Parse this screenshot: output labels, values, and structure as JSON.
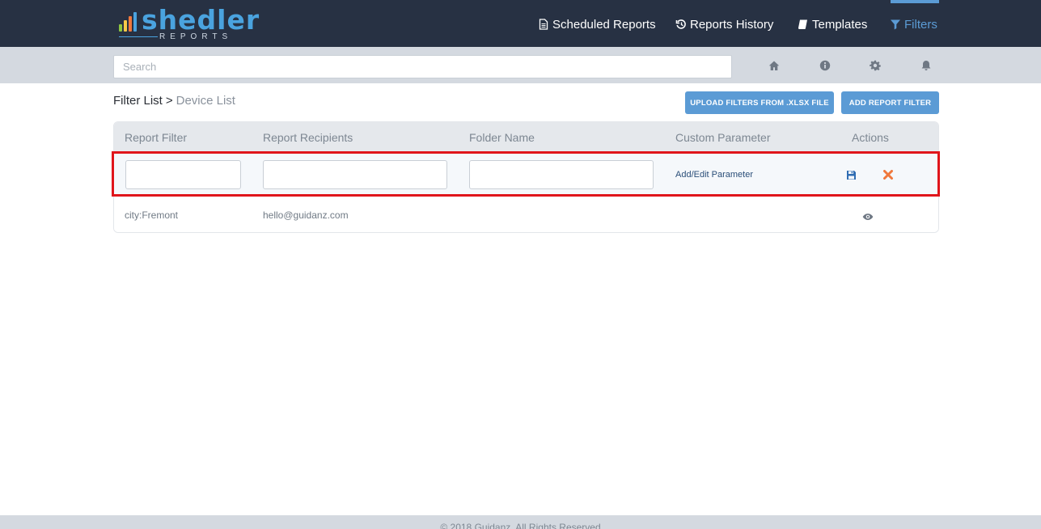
{
  "brand": {
    "name": "shedler",
    "sub": "REPORTS",
    "accent": "#4aa3df"
  },
  "nav": {
    "items": [
      {
        "label": "Scheduled Reports",
        "icon": "file-text-icon"
      },
      {
        "label": "Reports History",
        "icon": "history-icon"
      },
      {
        "label": "Templates",
        "icon": "book-icon"
      },
      {
        "label": "Filters",
        "icon": "filter-icon",
        "active": true
      }
    ],
    "active_color": "#5b9bd5"
  },
  "search": {
    "placeholder": "Search",
    "value": ""
  },
  "toolbar": {
    "icons": [
      "home-icon",
      "info-icon",
      "gear-icon",
      "bell-icon"
    ]
  },
  "breadcrumb": {
    "parent": "Filter List",
    "separator": ">",
    "current": "Device List"
  },
  "buttons": {
    "upload": "UPLOAD FILTERS FROM .XLSX FILE",
    "add": "ADD REPORT FILTER"
  },
  "table": {
    "headers": [
      "Report Filter",
      "Report Recipients",
      "Folder Name",
      "Custom Parameter",
      "Actions"
    ],
    "edit_row": {
      "report_filter": "",
      "report_recipients": "",
      "folder_name": "",
      "param_link": "Add/Edit Parameter",
      "actions": [
        "save-icon",
        "close-icon"
      ]
    },
    "rows": [
      {
        "report_filter": "city:Fremont",
        "report_recipients": "hello@guidanz.com",
        "folder_name": "",
        "custom_parameter": "",
        "actions": [
          "eye-icon"
        ]
      }
    ]
  },
  "footer": {
    "text": "© 2018 Guidanz. All Rights Reserved"
  },
  "colors": {
    "navbar": "#273143",
    "button": "#5b9bd5",
    "highlight": "#e0151b",
    "delete": "#f0783c",
    "save": "#2f6db3"
  }
}
